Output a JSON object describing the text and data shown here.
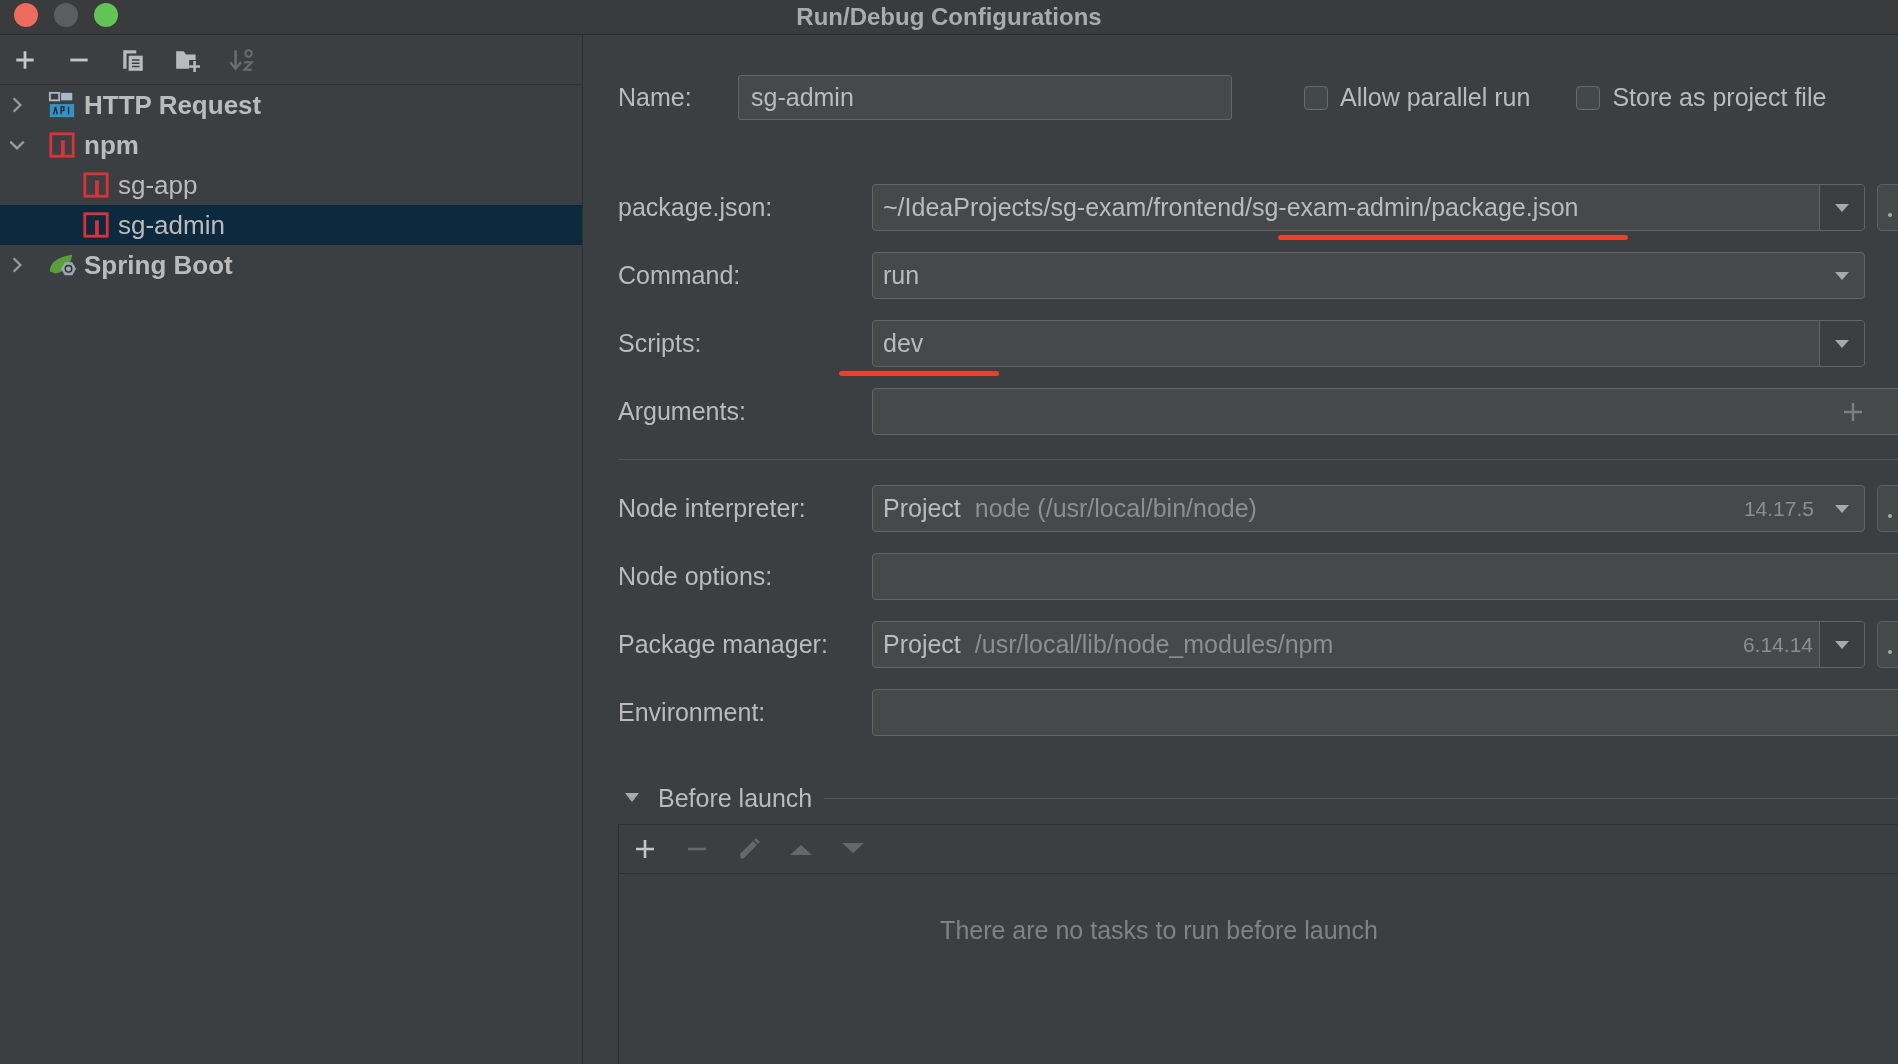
{
  "window": {
    "title": "Run/Debug Configurations"
  },
  "tree": [
    {
      "label": "HTTP Request",
      "kind": "api",
      "expanded": false,
      "selected": false
    },
    {
      "label": "npm",
      "kind": "npm",
      "expanded": true,
      "selected": false,
      "children": [
        {
          "label": "sg-app",
          "kind": "npm",
          "selected": false
        },
        {
          "label": "sg-admin",
          "kind": "npm",
          "selected": true
        }
      ]
    },
    {
      "label": "Spring Boot",
      "kind": "spring",
      "expanded": false,
      "selected": false
    }
  ],
  "name_field": {
    "label": "Name:",
    "value": "sg-admin"
  },
  "options": [
    {
      "label": "Allow parallel run",
      "checked": false
    },
    {
      "label": "Store as project file",
      "checked": false
    }
  ],
  "sections": [
    {
      "fields": [
        {
          "label": "package.json:",
          "kind": "combo",
          "value": "~/IdeaProjects/sg-exam/frontend/sg-exam-admin/package.json",
          "split": true,
          "browse": true,
          "underlined": true
        },
        {
          "label": "Command:",
          "kind": "combo",
          "value": "run",
          "split": false,
          "browse": false,
          "underlined": false
        },
        {
          "label": "Scripts:",
          "kind": "combo",
          "value": "dev",
          "split": true,
          "browse": false,
          "underlined": true
        },
        {
          "label": "Arguments:",
          "kind": "args"
        }
      ]
    },
    {
      "fields": [
        {
          "label": "Node interpreter:",
          "kind": "runtime",
          "prefix": "Project",
          "value": "node (/usr/local/bin/node)",
          "version": "14.17.5",
          "split": false,
          "browse": true
        },
        {
          "label": "Node options:",
          "kind": "options"
        },
        {
          "label": "Package manager:",
          "kind": "runtime",
          "prefix": "Project",
          "value": "/usr/local/lib/node_modules/npm",
          "version": "6.14.14",
          "split": true,
          "browse": true
        },
        {
          "label": "Environment:",
          "kind": "env"
        }
      ]
    }
  ],
  "before_launch": {
    "title": "Before launch",
    "expanded": true,
    "empty_message": "There are no tasks to run before launch"
  }
}
